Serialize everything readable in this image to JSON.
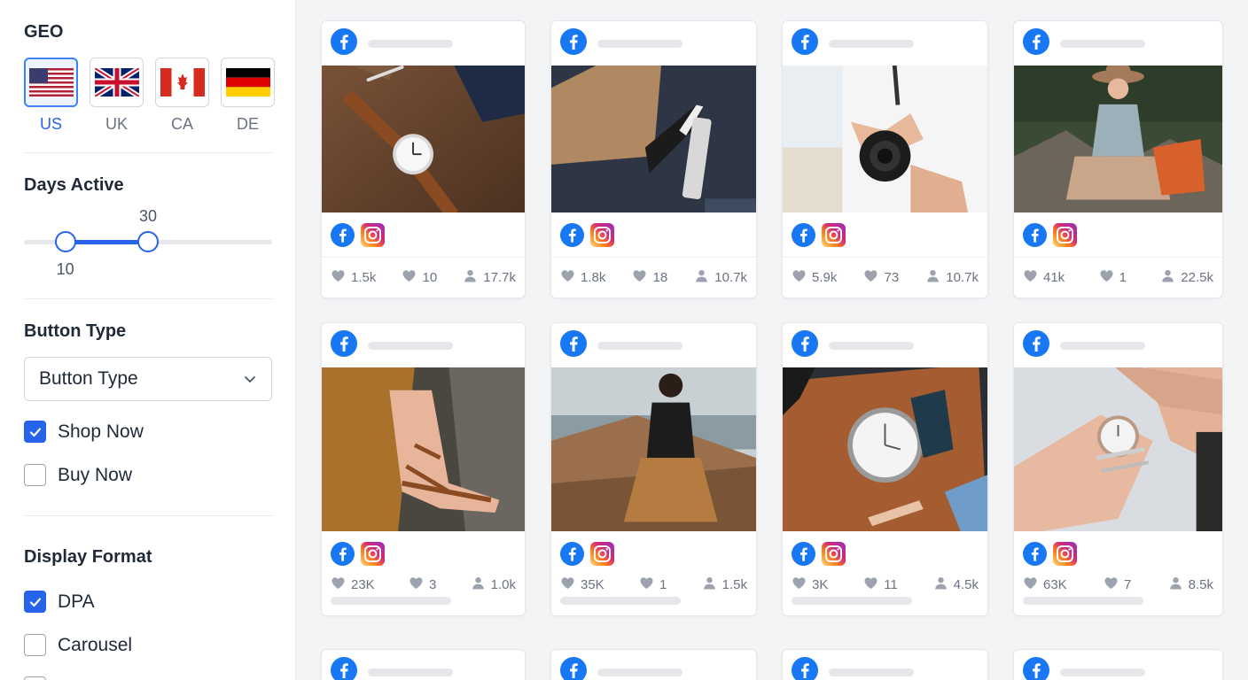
{
  "sidebar": {
    "geo": {
      "title": "GEO",
      "countries": [
        {
          "code": "US",
          "selected": true
        },
        {
          "code": "UK",
          "selected": false
        },
        {
          "code": "CA",
          "selected": false
        },
        {
          "code": "DE",
          "selected": false
        }
      ]
    },
    "days_active": {
      "title": "Days Active",
      "range_min": 0,
      "range_max": 60,
      "low": 10,
      "high": 30,
      "low_label": "10",
      "high_label": "30"
    },
    "button_type": {
      "title": "Button Type",
      "select_value": "Button Type",
      "options": [
        {
          "label": "Shop Now",
          "checked": true
        },
        {
          "label": "Buy Now",
          "checked": false
        }
      ]
    },
    "display_format": {
      "title": "Display Format",
      "options": [
        {
          "label": "DPA",
          "checked": true
        },
        {
          "label": "Carousel",
          "checked": false
        }
      ]
    }
  },
  "ads": [
    {
      "image": "watch-on-wood",
      "likes": "1.5k",
      "comments": "10",
      "reach": "17.7k"
    },
    {
      "image": "fitness-band",
      "likes": "1.8k",
      "comments": "18",
      "reach": "10.7k"
    },
    {
      "image": "camera-hands",
      "likes": "5.9k",
      "comments": "73",
      "reach": "10.7k"
    },
    {
      "image": "hat-woman-outdoors",
      "likes": "41k",
      "comments": "1",
      "reach": "22.5k"
    },
    {
      "image": "sandals",
      "likes": "23K",
      "comments": "3",
      "reach": "1.0k"
    },
    {
      "image": "woman-on-coast",
      "likes": "35K",
      "comments": "1",
      "reach": "1.5k"
    },
    {
      "image": "watch-on-leather",
      "likes": "3K",
      "comments": "11",
      "reach": "4.5k"
    },
    {
      "image": "watch-on-wrist",
      "likes": "63K",
      "comments": "7",
      "reach": "8.5k"
    }
  ],
  "colors": {
    "accent": "#2563eb",
    "facebook": "#1877f2",
    "instagram": "#d62976"
  }
}
